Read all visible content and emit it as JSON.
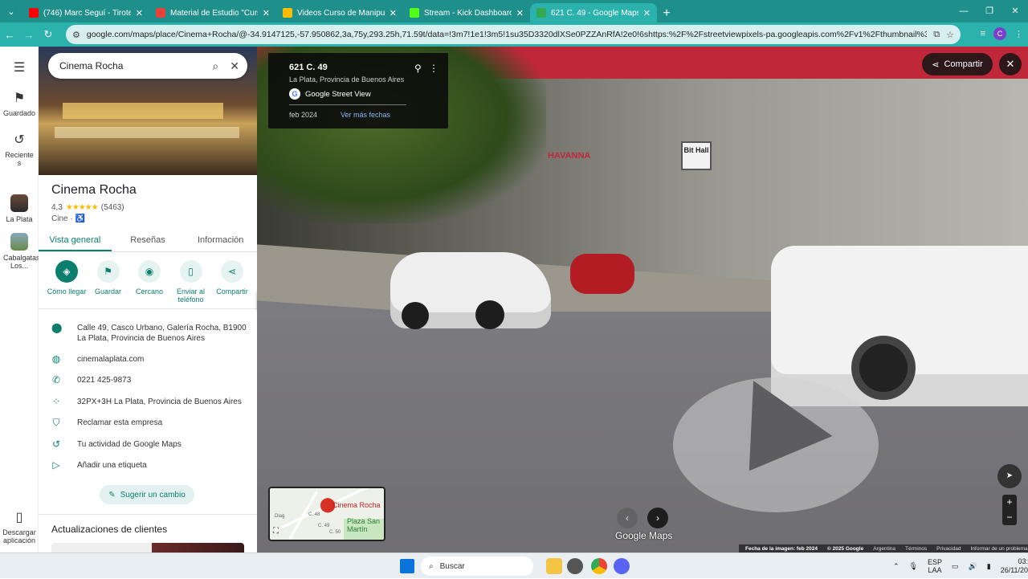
{
  "browser": {
    "tabs": [
      {
        "label": "(746) Marc Seguí - Tiroteo Rem",
        "favicon_color": "#ff0000",
        "active": false
      },
      {
        "label": "Material de Estudio \"Curso de",
        "favicon_color": "#e8433a",
        "active": false
      },
      {
        "label": "Videos Curso de Manipulación",
        "favicon_color": "#fbbc04",
        "active": false
      },
      {
        "label": "Stream - Kick Dashboard",
        "favicon_color": "#53fc18",
        "active": false
      },
      {
        "label": "621 C. 49 - Google Maps",
        "favicon_color": "#34a853",
        "active": true
      }
    ],
    "url": "google.com/maps/place/Cinema+Rocha/@-34.9147125,-57.950862,3a,75y,293.25h,71.59t/data=!3m7!1e1!3m5!1su35D3320dlXSe0PZZAnRfA!2e0!6shttps:%2F%2Fstreetviewpixels-pa.googleapis.com%2Fv1%2Fthumbnail%3Fcb_client%3Dmaps_sv.tactile...",
    "profile_initial": "C"
  },
  "rail": {
    "saved": "Guardado",
    "recents": "Recientes",
    "place1": "La Plata",
    "place2": "Cabalgatas Los...",
    "download": "Descargar aplicación"
  },
  "search": {
    "value": "Cinema Rocha"
  },
  "place": {
    "name": "Cinema Rocha",
    "rating": "4,3",
    "stars": "★★★★★",
    "reviews": "(5463)",
    "category": "Cine ·",
    "accessible_icon": "♿",
    "tabs": [
      "Vista general",
      "Reseñas",
      "Información"
    ],
    "actions": [
      "Cómo llegar",
      "Guardar",
      "Cercano",
      "Enviar al teléfono",
      "Compartir"
    ],
    "address": "Calle 49, Casco Urbano, Galería Rocha, B1900 La Plata, Provincia de Buenos Aires",
    "website": "cinemalaplata.com",
    "phone": "0221 425-9873",
    "plus_code": "32PX+3H La Plata, Provincia de Buenos Aires",
    "claim": "Reclamar esta empresa",
    "activity": "Tu actividad de Google Maps",
    "label": "Añadir una etiqueta",
    "suggest": "Sugerir un cambio",
    "updates_title": "Actualizaciones de clientes"
  },
  "streetview": {
    "address": "621 C. 49",
    "subtitle": "La Plata, Provincia de Buenos Aires",
    "source": "Google Street View",
    "date": "feb 2024",
    "more_dates": "Ver más fechas",
    "share": "Compartir",
    "sign_text": "Bit Hall",
    "brand": "HAVANNA",
    "minimap_label": "Cinema Rocha",
    "minimap_park": "Plaza San Martín",
    "minimap_streets": [
      "C. 48",
      "C. 49",
      "C. 50",
      "Diag"
    ],
    "logo": "Google Maps",
    "footer": {
      "date": "Fecha de la imagen: feb 2024",
      "copyright": "© 2025 Google",
      "country": "Argentina",
      "terms": "Términos",
      "privacy": "Privacidad",
      "report": "Informar de un problema"
    }
  },
  "taskbar": {
    "search": "Buscar",
    "lang1": "ESP",
    "lang2": "LAA",
    "time": "03:34",
    "date": "26/11/2025"
  }
}
